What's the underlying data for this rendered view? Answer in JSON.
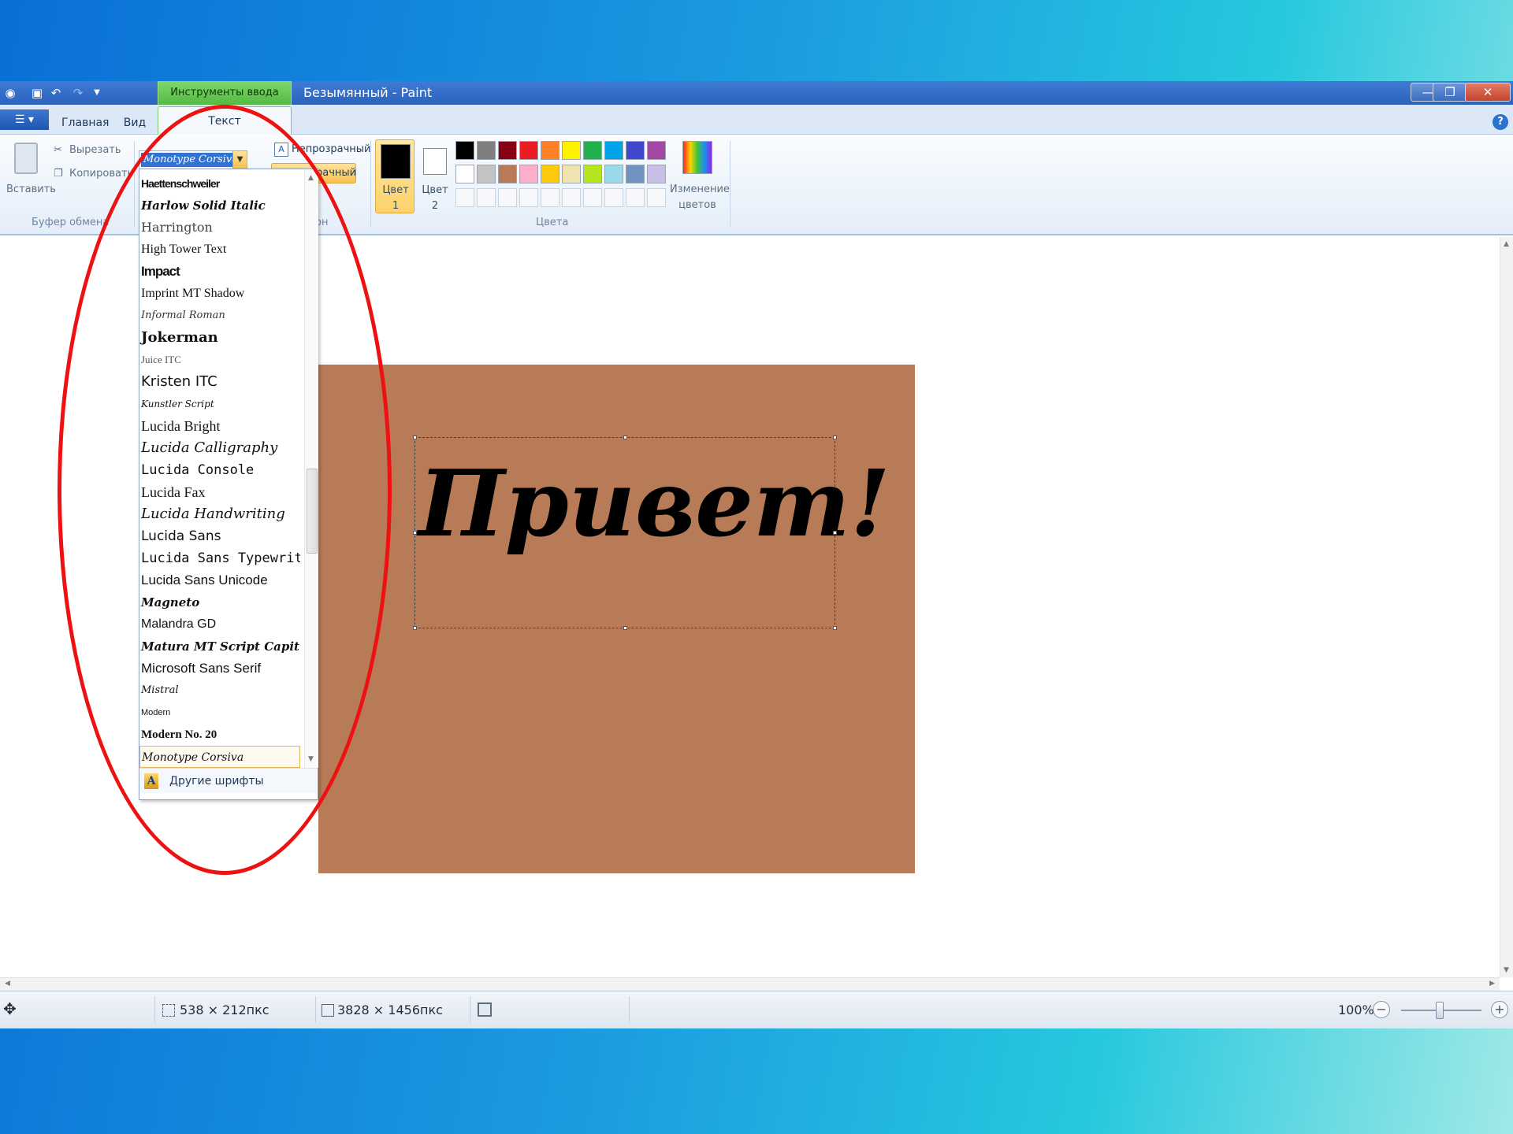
{
  "window": {
    "title": "Безымянный - Paint",
    "context_group": "Инструменты ввода текста"
  },
  "tabs": {
    "home": "Главная",
    "view": "Вид",
    "text": "Текст"
  },
  "clipboard": {
    "paste": "Вставить",
    "cut": "Вырезать",
    "copy": "Копировать",
    "group_label": "Буфер обмена"
  },
  "font": {
    "current": "Monotype Corsiva"
  },
  "background": {
    "opaque": "Непрозрачный",
    "transparent_fragment": "рачный",
    "group_label_fragment": "он"
  },
  "colors": {
    "color1_line1": "Цвет",
    "color1_line2": "1",
    "color2_line1": "Цвет",
    "color2_line2": "2",
    "edit_line1": "Изменение",
    "edit_line2": "цветов",
    "group_label": "Цвета",
    "color1_value": "#000000",
    "color2_value": "#ffffff",
    "palette_row1": [
      "#000000",
      "#7f7f7f",
      "#880015",
      "#ed1c24",
      "#ff7f27",
      "#fff200",
      "#22b14c",
      "#00a2e8",
      "#3f48cc",
      "#a349a4"
    ],
    "palette_row2": [
      "#ffffff",
      "#c3c3c3",
      "#b97a57",
      "#ffaec9",
      "#ffc90e",
      "#efe4b0",
      "#b5e61d",
      "#99d9ea",
      "#7092be",
      "#c8bfe7"
    ]
  },
  "dropdown": {
    "fonts": [
      "Haettenschweiler",
      "Harlow Solid Italic",
      "Harrington",
      "High Tower Text",
      "Impact",
      "Imprint MT Shadow",
      "Informal Roman",
      "Jokerman",
      "Juice ITC",
      "Kristen ITC",
      "Kunstler Script",
      "Lucida Bright",
      "Lucida Calligraphy",
      "Lucida Console",
      "Lucida Fax",
      "Lucida Handwriting",
      "Lucida Sans",
      "Lucida Sans Typewrit",
      "Lucida Sans Unicode",
      "Magneto",
      "Malandra GD",
      "Matura MT Script Capit",
      "Microsoft Sans Serif",
      "Mistral",
      "Modern",
      "Modern No. 20",
      "Monotype Corsiva"
    ],
    "more_fonts": "Другие шрифты"
  },
  "canvas": {
    "text": "Привет!",
    "fill_color": "#b77b57"
  },
  "status": {
    "selection_size": "538 × 212пкс",
    "image_size": "3828 × 1456пкс",
    "zoom": "100%"
  }
}
